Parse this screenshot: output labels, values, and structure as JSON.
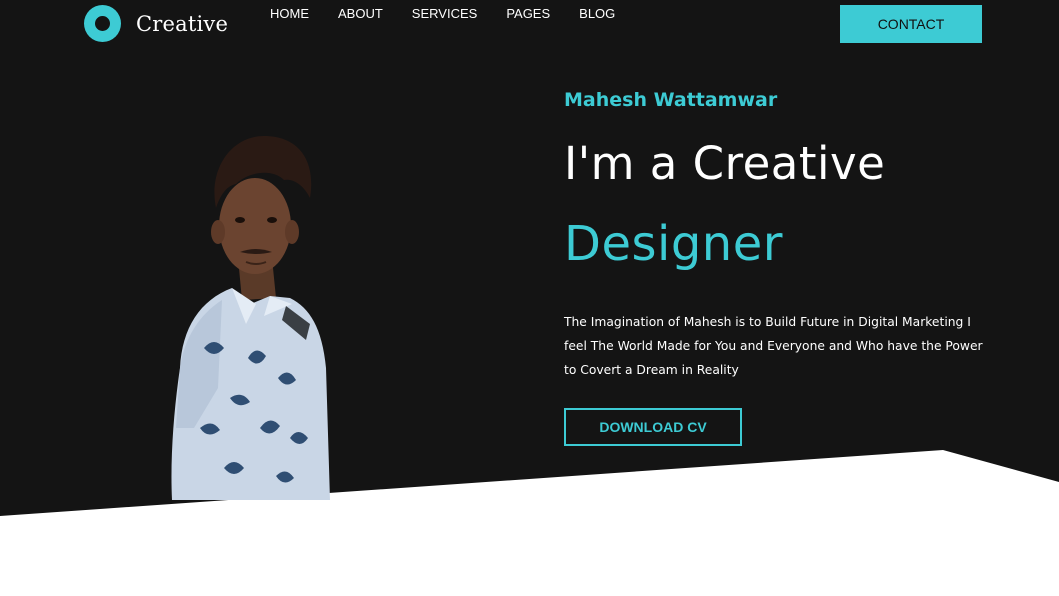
{
  "brand": {
    "name": "Creative",
    "accent_color": "#3dcbd4",
    "background_color": "#141414"
  },
  "nav": {
    "items": [
      "HOME",
      "ABOUT",
      "SERVICES",
      "PAGES",
      "BLOG"
    ]
  },
  "contact_button": {
    "label": "CONTACT"
  },
  "hero": {
    "name": "Mahesh Wattamwar",
    "title": "I'm a Creative",
    "role": "Designer",
    "description": "The Imagination of Mahesh is to Build Future in Digital Marketing I feel The World Made for You and Everyone and Who have the Power to Covert a Dream in Reality",
    "download_label": "DOWNLOAD CV",
    "portrait_icon": "person-photo"
  }
}
